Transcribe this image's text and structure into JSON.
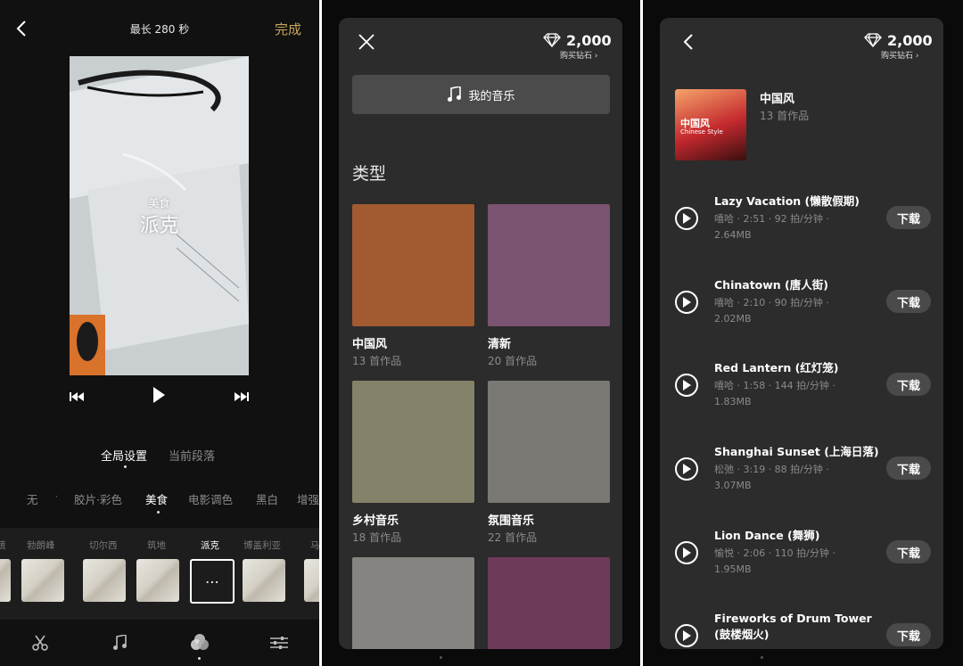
{
  "editor": {
    "max_length": "最长 280 秒",
    "done_label": "完成",
    "preview_caption_small": "美食",
    "preview_caption_big": "派克",
    "scope_tabs": [
      "全局设置",
      "当前段落"
    ],
    "filter_categories": [
      "无",
      "胶片·彩色",
      "美食",
      "电影调色",
      "黑白",
      "增强"
    ],
    "filter_names": [
      "蔬",
      "勃朗峰",
      "切尔西",
      "筑地",
      "派克",
      "博盖利亚",
      "马"
    ],
    "selected_filter_icon": "⋯",
    "toolbar_icons": [
      "scissors-icon",
      "music-note-icon",
      "filter-circles-icon",
      "adjust-sliders-icon"
    ]
  },
  "genres": {
    "balance": "2,000",
    "buy_label": "购买钻石",
    "my_music_label": "我的音乐",
    "section_title": "类型",
    "tiles": [
      {
        "name": "中国风",
        "count": "13 首作品",
        "color": "#a25a30"
      },
      {
        "name": "清新",
        "count": "20 首作品",
        "color": "#7a5471"
      },
      {
        "name": "乡村音乐",
        "count": "18 首作品",
        "color": "#85826a"
      },
      {
        "name": "氛围音乐",
        "count": "22 首作品",
        "color": "#7a7873"
      },
      {
        "name": "",
        "count": "",
        "color": "#858481"
      },
      {
        "name": "",
        "count": "",
        "color": "#6e3a5a"
      }
    ]
  },
  "album": {
    "balance": "2,000",
    "buy_label": "购买钻石",
    "title": "中国风",
    "count": "13 首作品",
    "cover_text_cn": "中国风",
    "cover_text_en": "Chinese Style",
    "download_label": "下载",
    "tracks": [
      {
        "title": "Lazy Vacation (懒散假期)",
        "meta1": "嘻哈 · 2:51 · 92 拍/分钟 ·",
        "meta2": "2.64MB"
      },
      {
        "title": "Chinatown (唐人街)",
        "meta1": "嘻哈 · 2:10 · 90 拍/分钟 ·",
        "meta2": "2.02MB"
      },
      {
        "title": "Red Lantern (红灯笼)",
        "meta1": "嘻哈 · 1:58 · 144 拍/分钟 ·",
        "meta2": "1.83MB"
      },
      {
        "title": "Shanghai Sunset (上海日落)",
        "meta1": "松弛 · 3:19 · 88 拍/分钟 ·",
        "meta2": "3.07MB"
      },
      {
        "title": "Lion Dance (舞狮)",
        "meta1": "愉悦 · 2:06 · 110 拍/分钟 ·",
        "meta2": "1.95MB"
      },
      {
        "title": "Fireworks of Drum Tower (鼓楼烟火)",
        "meta1": "",
        "meta2": ""
      }
    ]
  }
}
